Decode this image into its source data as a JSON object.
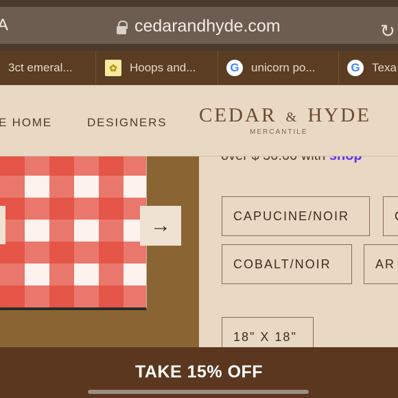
{
  "browser": {
    "left_fragment": "A",
    "url": "cedarandhyde.com",
    "reload_icon": "↻",
    "tabs": [
      {
        "label": "3ct emeral...",
        "icon": ""
      },
      {
        "label": "Hoops and...",
        "icon": "kendra-scott-icon"
      },
      {
        "label": "unicorn po...",
        "icon": "google-icon"
      },
      {
        "label": "Texa",
        "icon": "google-icon"
      }
    ],
    "google_glyph": "G",
    "kendra_glyph": "✿"
  },
  "header": {
    "nav_home": "E HOME",
    "nav_designers": "DESIGNERS",
    "logo_cedar": "CEDAR",
    "logo_amp": "&",
    "logo_hyde": "HYDE",
    "logo_sub": "MERCANTILE"
  },
  "product": {
    "next_arrow": "→",
    "price_line_prefix": "over $ 50.00 with ",
    "shop_pay": "shop"
  },
  "options": {
    "colors": [
      "CAPUCINE/NOIR",
      "C",
      "COBALT/NOIR",
      "AR"
    ],
    "size": "18\" X 18\""
  },
  "promo": {
    "label": "TAKE 15% OFF"
  },
  "colors": {
    "brand_brown": "#5a371e",
    "cream": "#e8d8c4",
    "shop_pay_purple": "#5a31f4"
  }
}
